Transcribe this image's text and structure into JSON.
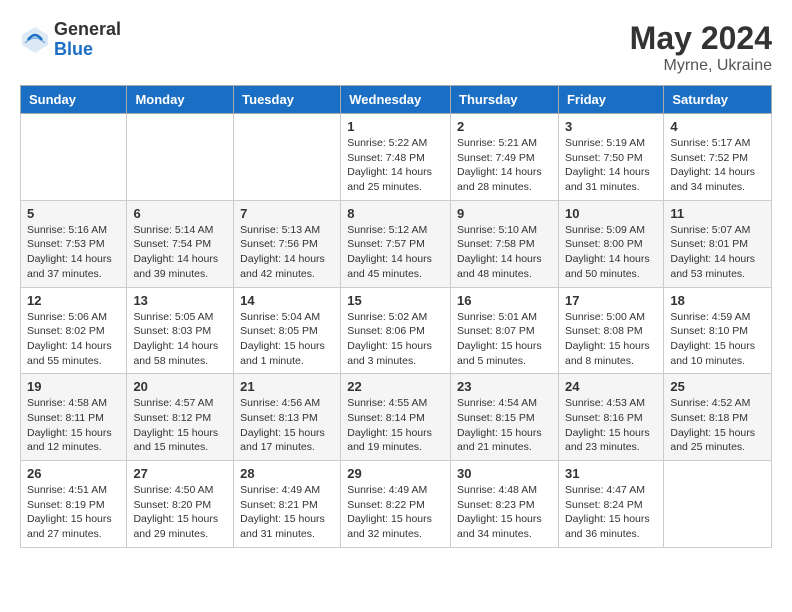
{
  "header": {
    "logo_general": "General",
    "logo_blue": "Blue",
    "month_year": "May 2024",
    "location": "Myrne, Ukraine"
  },
  "weekdays": [
    "Sunday",
    "Monday",
    "Tuesday",
    "Wednesday",
    "Thursday",
    "Friday",
    "Saturday"
  ],
  "weeks": [
    [
      {
        "day": "",
        "info": ""
      },
      {
        "day": "",
        "info": ""
      },
      {
        "day": "",
        "info": ""
      },
      {
        "day": "1",
        "info": "Sunrise: 5:22 AM\nSunset: 7:48 PM\nDaylight: 14 hours\nand 25 minutes."
      },
      {
        "day": "2",
        "info": "Sunrise: 5:21 AM\nSunset: 7:49 PM\nDaylight: 14 hours\nand 28 minutes."
      },
      {
        "day": "3",
        "info": "Sunrise: 5:19 AM\nSunset: 7:50 PM\nDaylight: 14 hours\nand 31 minutes."
      },
      {
        "day": "4",
        "info": "Sunrise: 5:17 AM\nSunset: 7:52 PM\nDaylight: 14 hours\nand 34 minutes."
      }
    ],
    [
      {
        "day": "5",
        "info": "Sunrise: 5:16 AM\nSunset: 7:53 PM\nDaylight: 14 hours\nand 37 minutes."
      },
      {
        "day": "6",
        "info": "Sunrise: 5:14 AM\nSunset: 7:54 PM\nDaylight: 14 hours\nand 39 minutes."
      },
      {
        "day": "7",
        "info": "Sunrise: 5:13 AM\nSunset: 7:56 PM\nDaylight: 14 hours\nand 42 minutes."
      },
      {
        "day": "8",
        "info": "Sunrise: 5:12 AM\nSunset: 7:57 PM\nDaylight: 14 hours\nand 45 minutes."
      },
      {
        "day": "9",
        "info": "Sunrise: 5:10 AM\nSunset: 7:58 PM\nDaylight: 14 hours\nand 48 minutes."
      },
      {
        "day": "10",
        "info": "Sunrise: 5:09 AM\nSunset: 8:00 PM\nDaylight: 14 hours\nand 50 minutes."
      },
      {
        "day": "11",
        "info": "Sunrise: 5:07 AM\nSunset: 8:01 PM\nDaylight: 14 hours\nand 53 minutes."
      }
    ],
    [
      {
        "day": "12",
        "info": "Sunrise: 5:06 AM\nSunset: 8:02 PM\nDaylight: 14 hours\nand 55 minutes."
      },
      {
        "day": "13",
        "info": "Sunrise: 5:05 AM\nSunset: 8:03 PM\nDaylight: 14 hours\nand 58 minutes."
      },
      {
        "day": "14",
        "info": "Sunrise: 5:04 AM\nSunset: 8:05 PM\nDaylight: 15 hours\nand 1 minute."
      },
      {
        "day": "15",
        "info": "Sunrise: 5:02 AM\nSunset: 8:06 PM\nDaylight: 15 hours\nand 3 minutes."
      },
      {
        "day": "16",
        "info": "Sunrise: 5:01 AM\nSunset: 8:07 PM\nDaylight: 15 hours\nand 5 minutes."
      },
      {
        "day": "17",
        "info": "Sunrise: 5:00 AM\nSunset: 8:08 PM\nDaylight: 15 hours\nand 8 minutes."
      },
      {
        "day": "18",
        "info": "Sunrise: 4:59 AM\nSunset: 8:10 PM\nDaylight: 15 hours\nand 10 minutes."
      }
    ],
    [
      {
        "day": "19",
        "info": "Sunrise: 4:58 AM\nSunset: 8:11 PM\nDaylight: 15 hours\nand 12 minutes."
      },
      {
        "day": "20",
        "info": "Sunrise: 4:57 AM\nSunset: 8:12 PM\nDaylight: 15 hours\nand 15 minutes."
      },
      {
        "day": "21",
        "info": "Sunrise: 4:56 AM\nSunset: 8:13 PM\nDaylight: 15 hours\nand 17 minutes."
      },
      {
        "day": "22",
        "info": "Sunrise: 4:55 AM\nSunset: 8:14 PM\nDaylight: 15 hours\nand 19 minutes."
      },
      {
        "day": "23",
        "info": "Sunrise: 4:54 AM\nSunset: 8:15 PM\nDaylight: 15 hours\nand 21 minutes."
      },
      {
        "day": "24",
        "info": "Sunrise: 4:53 AM\nSunset: 8:16 PM\nDaylight: 15 hours\nand 23 minutes."
      },
      {
        "day": "25",
        "info": "Sunrise: 4:52 AM\nSunset: 8:18 PM\nDaylight: 15 hours\nand 25 minutes."
      }
    ],
    [
      {
        "day": "26",
        "info": "Sunrise: 4:51 AM\nSunset: 8:19 PM\nDaylight: 15 hours\nand 27 minutes."
      },
      {
        "day": "27",
        "info": "Sunrise: 4:50 AM\nSunset: 8:20 PM\nDaylight: 15 hours\nand 29 minutes."
      },
      {
        "day": "28",
        "info": "Sunrise: 4:49 AM\nSunset: 8:21 PM\nDaylight: 15 hours\nand 31 minutes."
      },
      {
        "day": "29",
        "info": "Sunrise: 4:49 AM\nSunset: 8:22 PM\nDaylight: 15 hours\nand 32 minutes."
      },
      {
        "day": "30",
        "info": "Sunrise: 4:48 AM\nSunset: 8:23 PM\nDaylight: 15 hours\nand 34 minutes."
      },
      {
        "day": "31",
        "info": "Sunrise: 4:47 AM\nSunset: 8:24 PM\nDaylight: 15 hours\nand 36 minutes."
      },
      {
        "day": "",
        "info": ""
      }
    ]
  ]
}
